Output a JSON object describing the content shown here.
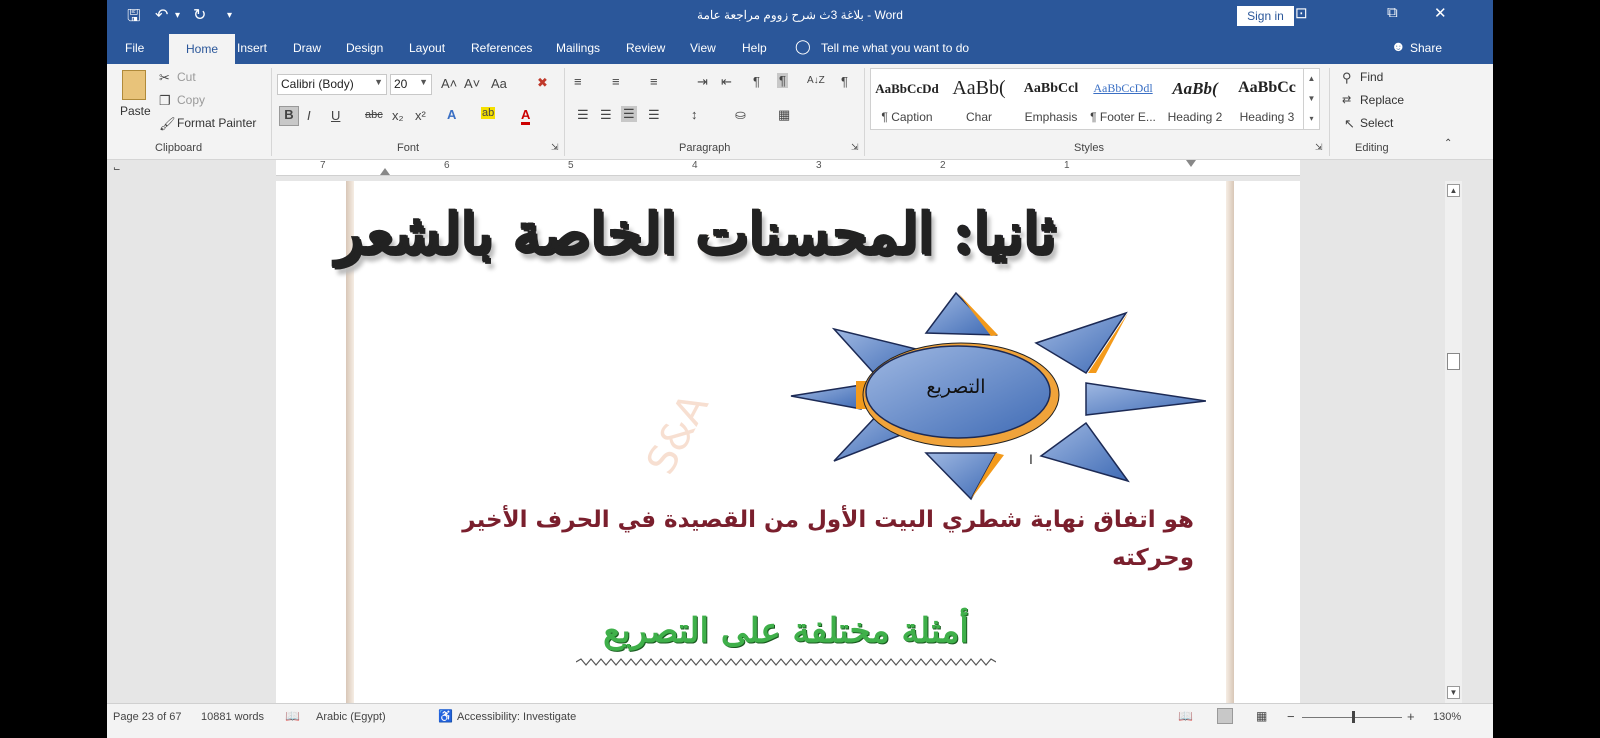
{
  "window": {
    "title": "بلاغة 3ث شرح زووم مراجعة عامة  -  Word",
    "sign_in": "Sign in",
    "controls": {
      "ribbon_display": "⊡",
      "restore": "⧉",
      "close": "✕"
    }
  },
  "quick_access": {
    "save": "🖫",
    "undo": "↶",
    "undo_dd": "▾",
    "redo": "↻",
    "customize": "▾"
  },
  "tabs": [
    "File",
    "Home",
    "Insert",
    "Draw",
    "Design",
    "Layout",
    "References",
    "Mailings",
    "Review",
    "View",
    "Help"
  ],
  "tell_me": "Tell me what you want to do",
  "share": "Share",
  "ribbon": {
    "clipboard": {
      "paste": "Paste",
      "cut": "Cut",
      "copy": "Copy",
      "format_painter": "Format Painter",
      "label": "Clipboard"
    },
    "font": {
      "font_name": "Calibri (Body)",
      "font_size": "20",
      "grow": "A˄",
      "shrink": "A˅",
      "change_case": "Aa",
      "bold": "B",
      "italic": "I",
      "underline": "U",
      "strike": "abc",
      "subscript": "x₂",
      "superscript": "x²",
      "text_effects": "A",
      "highlight": "ab",
      "font_color": "A",
      "label": "Font"
    },
    "paragraph": {
      "label": "Paragraph",
      "pilcrow": "¶",
      "sort": "A↓Z"
    },
    "styles": {
      "items": [
        {
          "preview": "AaBbCcDd",
          "name": "¶ Caption"
        },
        {
          "preview": "AaBb(",
          "name": "Char"
        },
        {
          "preview": "AaBbCcl",
          "name": "Emphasis"
        },
        {
          "preview": "AaBbCcDdl",
          "name": "¶ Footer E..."
        },
        {
          "preview": "AaBb(",
          "name": "Heading 2"
        },
        {
          "preview": "AaBbCc",
          "name": "Heading 3"
        }
      ],
      "label": "Styles"
    },
    "editing": {
      "find": "Find",
      "replace": "Replace",
      "select": "Select",
      "label": "Editing"
    }
  },
  "ruler": {
    "numbers": [
      "7",
      "6",
      "5",
      "4",
      "3",
      "2",
      "1"
    ]
  },
  "document": {
    "heading": "ثانيا: المحسنات الخاصة بالشعر",
    "sun_label": "التصريع",
    "body": "هو اتفاق نهاية شطري البيت الأول من القصيدة في الحرف الأخير وحركته",
    "subheading": "أمثلة مختلفة على التصريع",
    "watermark": "S&A"
  },
  "status": {
    "page": "Page 23 of 67",
    "words": "10881 words",
    "language": "Arabic (Egypt)",
    "accessibility": "Accessibility: Investigate",
    "zoom_minus": "−",
    "zoom_plus": "+",
    "zoom": "130%"
  },
  "colors": {
    "titlebar": "#2b579a",
    "ribbon": "#f3f3f3",
    "body_text": "#7a1f2d",
    "subheading": "#3fb04a"
  }
}
